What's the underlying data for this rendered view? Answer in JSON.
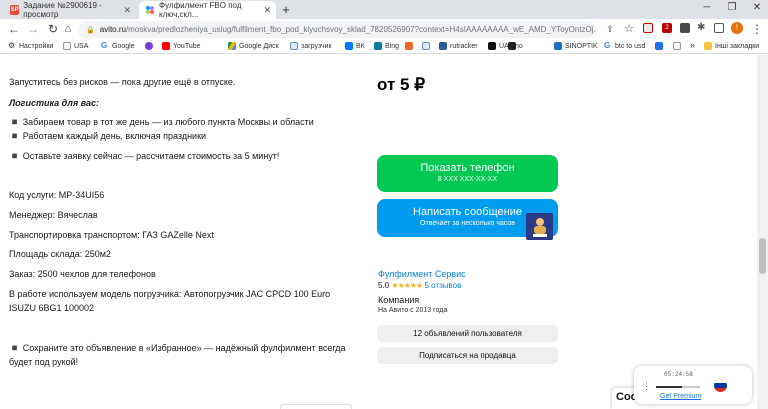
{
  "browser": {
    "tabs": [
      {
        "favicon": "SP",
        "title": "Задание №2900619 - просмотр"
      },
      {
        "favicon": "avito-icon",
        "title": "Фулфилмент FBO под ключ,скл..."
      }
    ],
    "address": {
      "domain": "avito.ru",
      "path": "/moskva/predlozheniya_uslug/fulfilment_fbo_pod_klyuchsvoy_sklad_7820526907?context=H4sIAAAAAAAA_wE_AMD_YToyOntzOj..."
    },
    "extension_badge": "2",
    "profile_initial": "!",
    "bookmarks": [
      "Настройки",
      "USA",
      "Google",
      "",
      "YouTube",
      "Google Диск",
      "загрузчик",
      "ВК",
      "Bing",
      "",
      "",
      "rutracker",
      "UAKino",
      "",
      "SINOPTIK",
      "btc to usd",
      "",
      ""
    ],
    "bookmarks_more": "»",
    "other_bookmarks": "Інші закладки"
  },
  "listing": {
    "lines": [
      "Запуститесь без рисков — пока другие ещё в отпуске.",
      "Логистика для вас:",
      "◾ Забираем товар в тот же день — из любого пункта Москвы и области",
      "◾ Работаем каждый день, включая праздники",
      "◾ Оставьте заявку сейчас — рассчитаем стоимость за 5 минут!",
      "Код услуги: MP-34UI56",
      "Менеджер: Вячеслав",
      "Транспортировка транспортом: ГАЗ GAZelle Next",
      "Площадь склада: 250м2",
      "Заказ: 2500 чехлов для телефонов",
      "В работе используем модель погрузчика: Автопогрузчик JAC CPCD 100 Euro",
      "ISUZU 6BG1 100002",
      "◾ Сохраните это объявление в «Избранное» — надёжный фулфилмент всегда",
      "будет под рукой!"
    ]
  },
  "sidebar": {
    "price": "от 5 ₽",
    "show_phone": {
      "label": "Показать телефон",
      "sub": "8 XXX XXX-XX-XX"
    },
    "message": {
      "label": "Написать сообщение",
      "sub": "Отвечает за несколько часов"
    },
    "seller": {
      "name": "Фулфилмент Сервис",
      "rating": "5.0",
      "stars": "★★★★★",
      "reviews": "5 отзывов",
      "type": "Компания",
      "since": "На Авито с 2013 года"
    },
    "user_listings": "12 объявлений пользователя",
    "subscribe": "Подписаться на продавца"
  },
  "player": {
    "time": "05:24:58",
    "premium": "Get Premium"
  },
  "cookie_fragment": "Coo",
  "colors": {
    "green": "#00c853",
    "blue": "#009cf0",
    "link": "#0a84d6",
    "star": "#ffb021"
  }
}
